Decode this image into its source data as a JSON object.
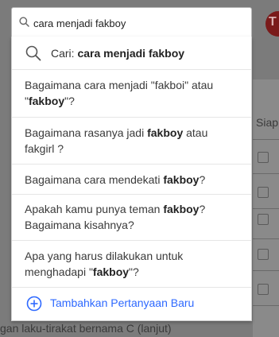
{
  "search": {
    "value": "cara menjadi fakboy",
    "placeholder": ""
  },
  "dropdown": {
    "search_prefix": "Cari:",
    "search_query": "cara menjadi fakboy",
    "questions": [
      {
        "parts": [
          "Bagaimana cara menjadi \"fakboi\" atau \"",
          "fakboy",
          "\"?"
        ]
      },
      {
        "parts": [
          "Bagaimana rasanya jadi ",
          "fakboy",
          " atau fakgirl ?"
        ]
      },
      {
        "parts": [
          "Bagaimana cara mendekati ",
          "fakboy",
          "?"
        ]
      },
      {
        "parts": [
          "Apakah kamu punya teman ",
          "fakboy",
          "? Bagaimana kisahnya?"
        ]
      },
      {
        "parts": [
          "Apa yang harus dilakukan untuk menghadapi \"",
          "fakboy",
          "\"?"
        ]
      }
    ],
    "add_question_label": "Tambahkan Pertanyaan Baru"
  },
  "background": {
    "right_header_fragment": "Siap",
    "bottom_text_fragment": "gan laku-tirakat bernama C (lanjut)"
  },
  "icons": {
    "search": "search-icon",
    "add": "plus-circle-icon"
  },
  "colors": {
    "accent": "#2e69ff",
    "overlay": "#7b7b7b"
  }
}
